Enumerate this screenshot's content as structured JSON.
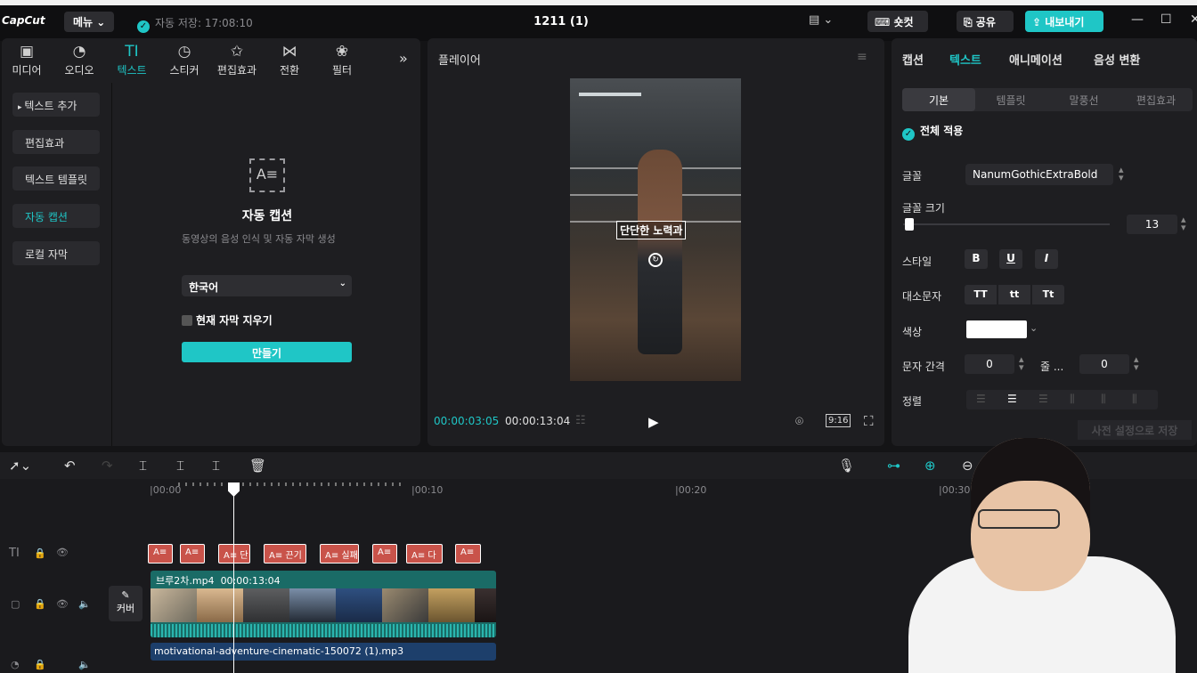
{
  "app": {
    "logo": "CapCut",
    "menu_label": "메뉴",
    "autosave": "자동 저장: 17:08:10",
    "title": "1211 (1)",
    "shortcut_label": "숏컷",
    "share_label": "공유",
    "export_label": "내보내기"
  },
  "toolbar": {
    "items": [
      {
        "label": "미디어",
        "icon": "▣"
      },
      {
        "label": "오디오",
        "icon": "◔"
      },
      {
        "label": "텍스트",
        "icon": "TI"
      },
      {
        "label": "스티커",
        "icon": "◷"
      },
      {
        "label": "편집효과",
        "icon": "✩"
      },
      {
        "label": "전환",
        "icon": "⋈"
      },
      {
        "label": "필터",
        "icon": "❀"
      }
    ],
    "more": "»"
  },
  "sidebar": {
    "items": [
      {
        "label": "텍스트 추가"
      },
      {
        "label": "편집효과"
      },
      {
        "label": "텍스트 템플릿"
      },
      {
        "label": "자동 캡션"
      },
      {
        "label": "로컬 자막"
      }
    ]
  },
  "autocaption": {
    "title": "자동 캡션",
    "desc": "동영상의 음성 인식 및 자동 자막 생성",
    "language": "한국어",
    "clear_label": "현재 자막 지우기",
    "create_label": "만들기"
  },
  "player": {
    "title": "플레이어",
    "caption": "단단한 노력과",
    "current_time": "00:00:03:05",
    "total_time": "00:00:13:04",
    "ratio": "9:16"
  },
  "right": {
    "tabs": [
      "캡션",
      "텍스트",
      "애니메이션",
      "음성 변환"
    ],
    "subtabs": [
      "기본",
      "템플릿",
      "말풍선",
      "편집효과"
    ],
    "apply_all": "전체 적용",
    "font_label": "글꼴",
    "font_value": "NanumGothicExtraBold",
    "size_label": "글꼴 크기",
    "size_value": "13",
    "style_label": "스타일",
    "style_b": "B",
    "style_u": "U",
    "style_i": "I",
    "case_label": "대소문자",
    "case_tt": "TT",
    "case_lower": "tt",
    "case_title": "Tt",
    "color_label": "색상",
    "color_value": "#ffffff",
    "spacing_label": "문자 간격",
    "spacing_value": "0",
    "line_label": "줄 ...",
    "line_value": "0",
    "align_label": "정렬",
    "save_preset": "사전 설정으로 저장"
  },
  "timeline": {
    "ruler": [
      "|00:00",
      "|00:10",
      "|00:20",
      "|00:30"
    ],
    "text_clips": [
      "A≡",
      "A≡",
      "A≡ 단",
      "A≡ 끈기",
      "A≡ 실패",
      "A≡",
      "A≡ 다",
      "A≡"
    ],
    "video_clip": {
      "name": "브루2차.mp4",
      "duration": "00:00:13:04"
    },
    "audio_clip": "motivational-adventure-cinematic-150072 (1).mp3",
    "cover_label": "커버"
  }
}
